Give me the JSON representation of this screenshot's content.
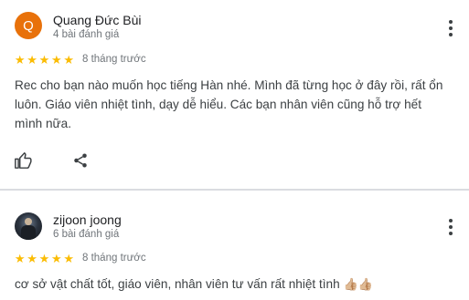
{
  "reviews": [
    {
      "avatar_letter": "Q",
      "author": "Quang Đức Bùi",
      "review_count": "4 bài đánh giá",
      "rating": 5,
      "stars": [
        "★",
        "★",
        "★",
        "★",
        "★"
      ],
      "time": "8 tháng trước",
      "text_lines": [
        "Rec cho bạn nào muốn học tiếng Hàn nhé. Mình đã từng học ở đây rồi, rất ổn",
        "luôn. Giáo viên nhiệt tình, dạy dễ hiểu. Các bạn nhân viên cũng hỗ trợ hết",
        "mình nữa."
      ],
      "avatar_color": "#e8710a"
    },
    {
      "author": "zijoon joong",
      "review_count": "6 bài đánh giá",
      "rating": 5,
      "stars": [
        "★",
        "★",
        "★",
        "★",
        "★"
      ],
      "time": "8 tháng trước",
      "text": "cơ sở vật chất tốt, giáo viên, nhân viên tư vấn rất nhiệt tình",
      "emojis": "👍🏼👍🏼"
    }
  ],
  "colors": {
    "star": "#fbbc04",
    "divider": "#dadce0",
    "muted": "#70757a"
  },
  "icons": [
    "more-vert-icon",
    "thumb-up-icon",
    "share-icon"
  ]
}
